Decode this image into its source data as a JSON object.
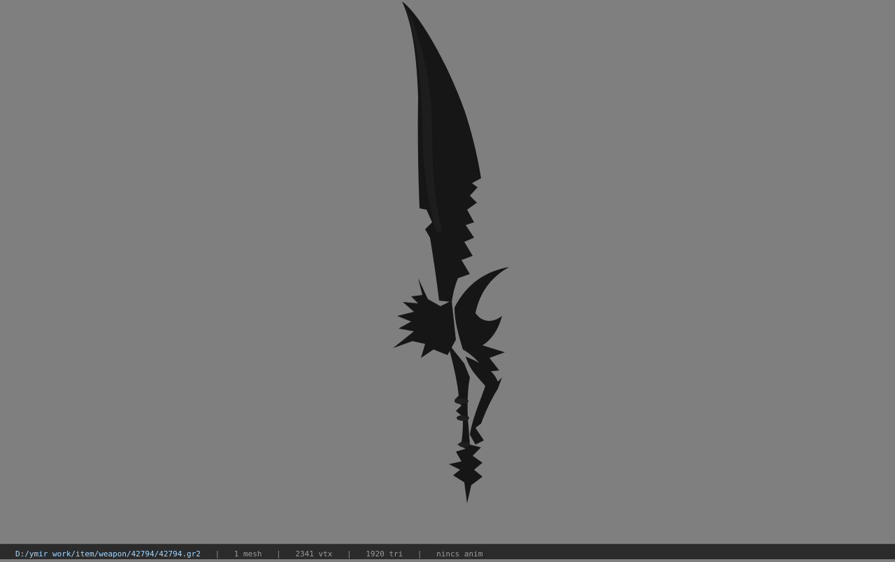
{
  "viewport": {
    "background": "#7f7f7f",
    "model": {
      "color": "#161616",
      "description_icon": "sword-model-icon"
    }
  },
  "statusbar": {
    "path": "D:/ymir work/item/weapon/42794/42794.gr2",
    "mesh": "1 mesh",
    "vertices": "2341 vtx",
    "triangles": "1920 tri",
    "animation": "nincs anim",
    "separator": "|",
    "path_color": "#9fd7ff",
    "text_color": "#9a9a9a"
  }
}
